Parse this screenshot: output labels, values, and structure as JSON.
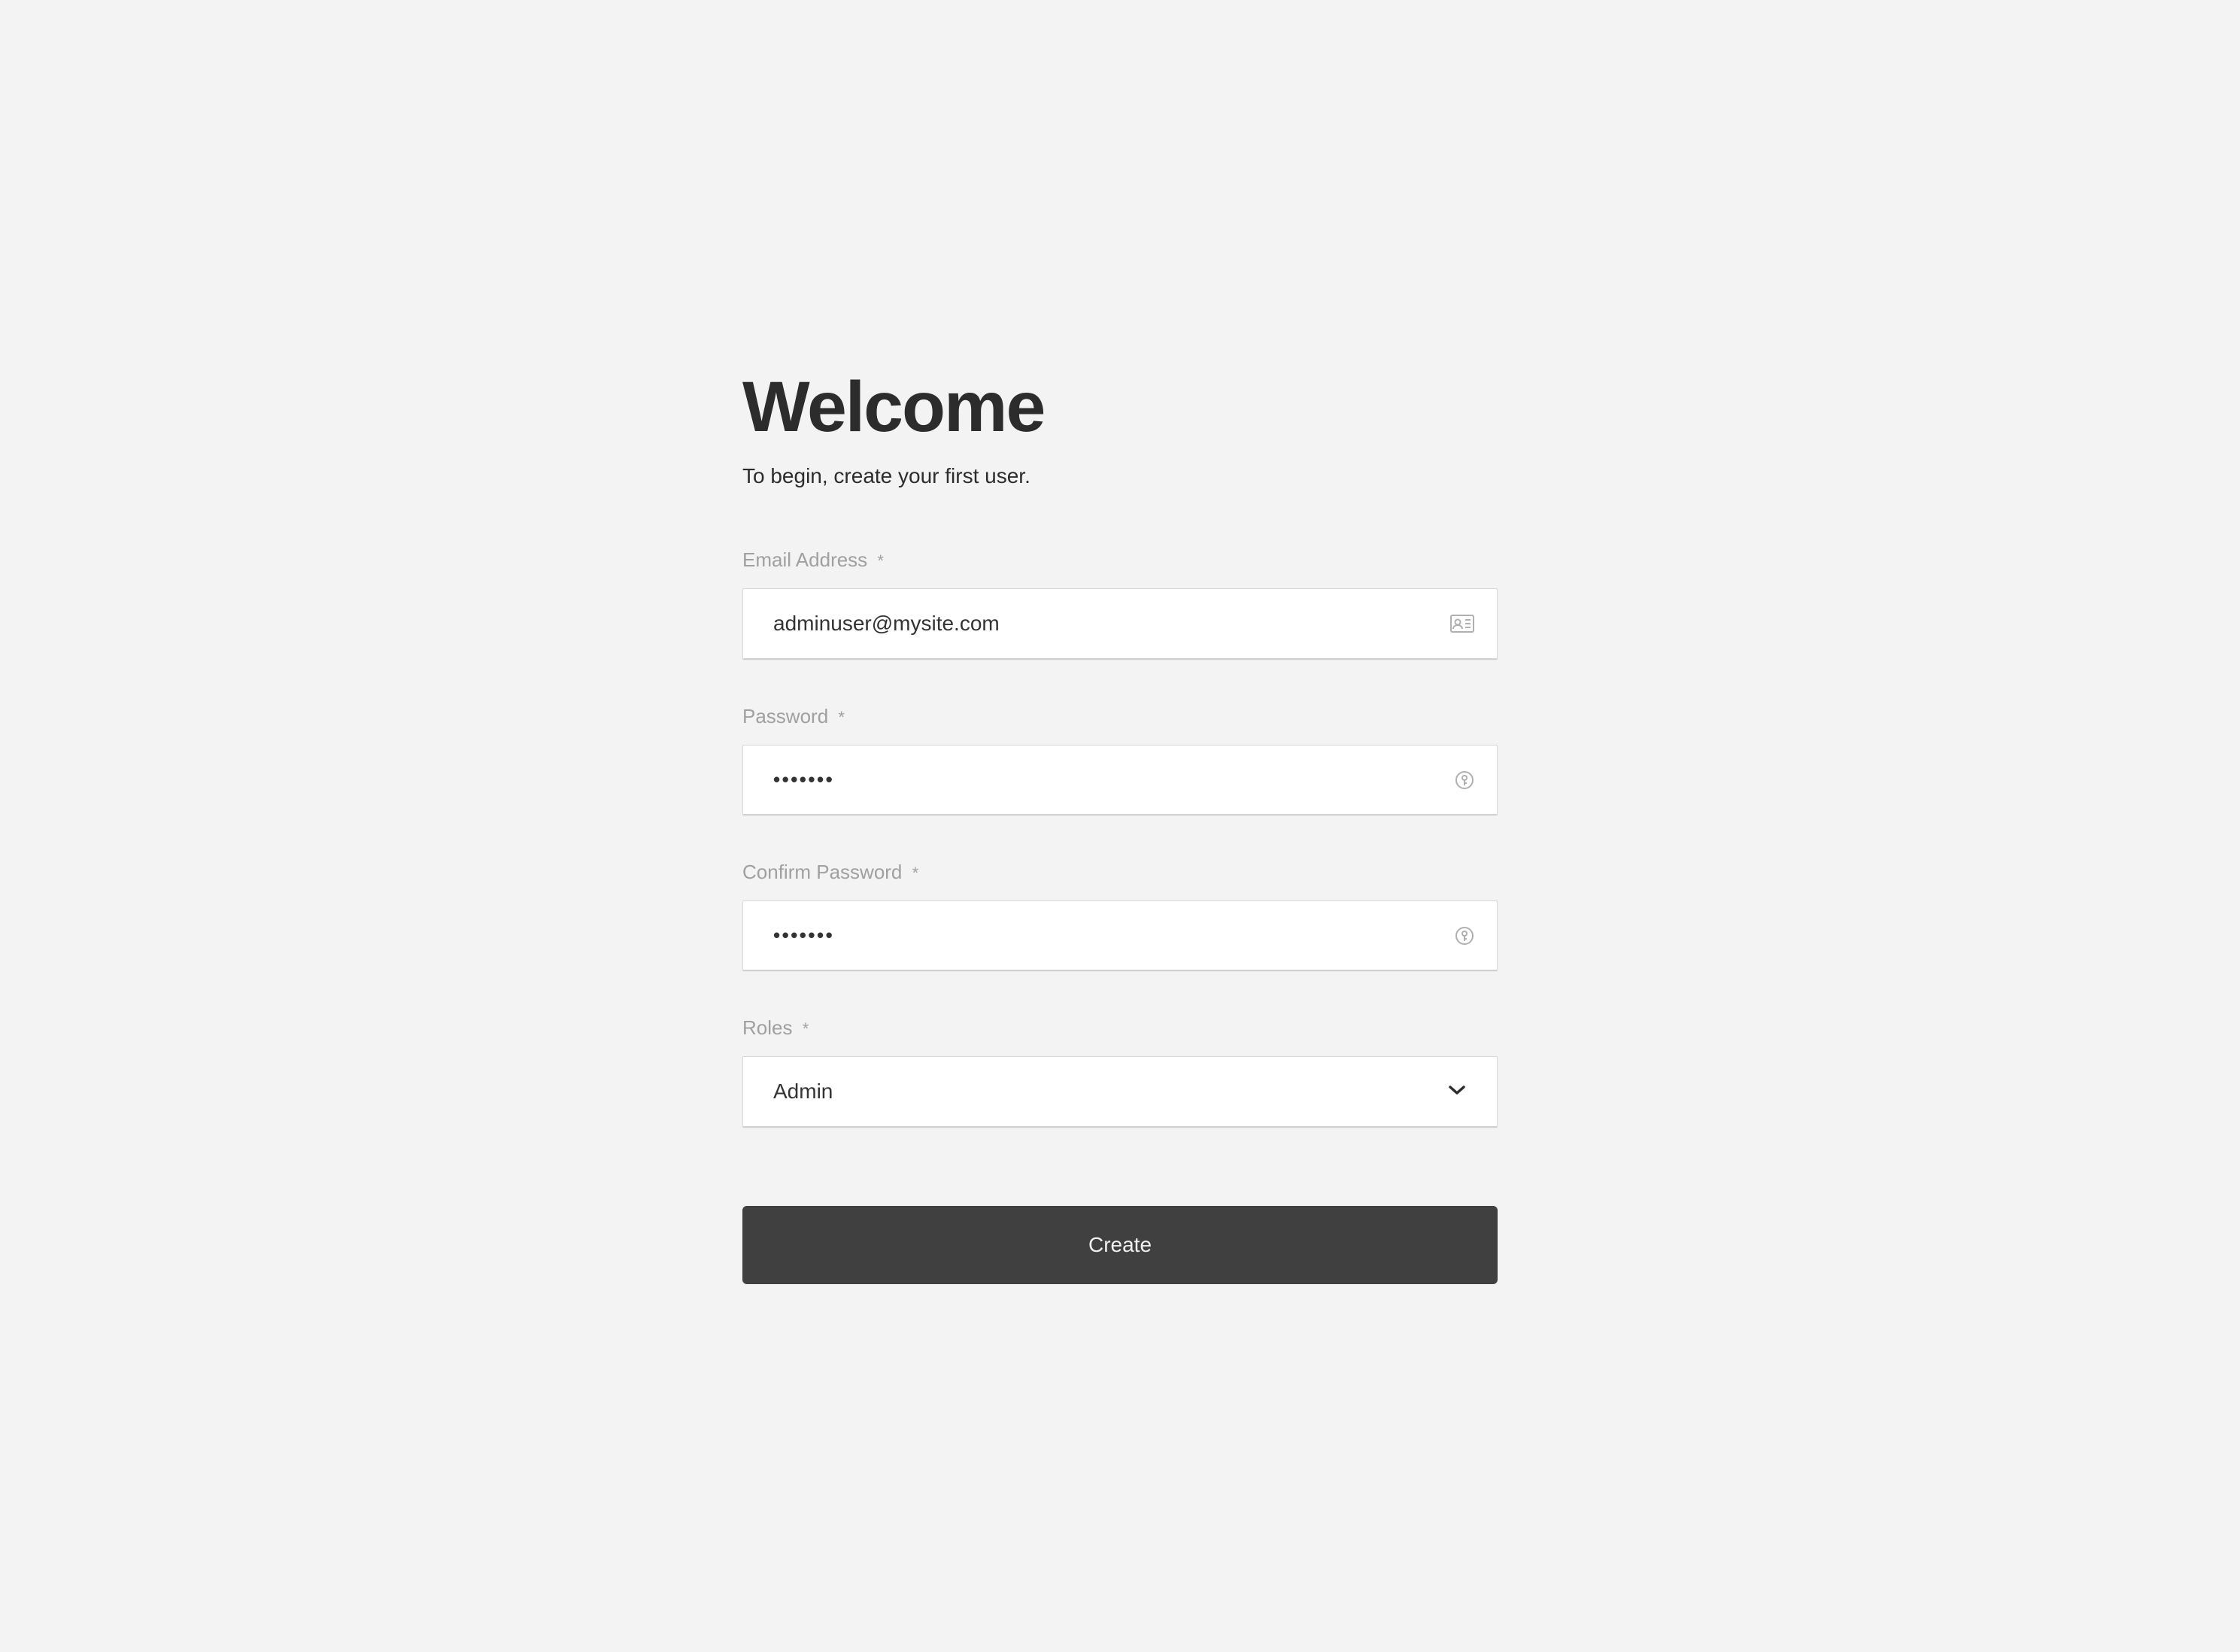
{
  "page": {
    "title": "Welcome",
    "subtitle": "To begin, create your first user."
  },
  "form": {
    "email": {
      "label": "Email Address",
      "required": "*",
      "value": "adminuser@mysite.com"
    },
    "password": {
      "label": "Password",
      "required": "*",
      "value": "•••••••"
    },
    "confirm_password": {
      "label": "Confirm Password",
      "required": "*",
      "value": "•••••••"
    },
    "roles": {
      "label": "Roles",
      "required": "*",
      "selected": "Admin"
    },
    "submit_label": "Create"
  }
}
